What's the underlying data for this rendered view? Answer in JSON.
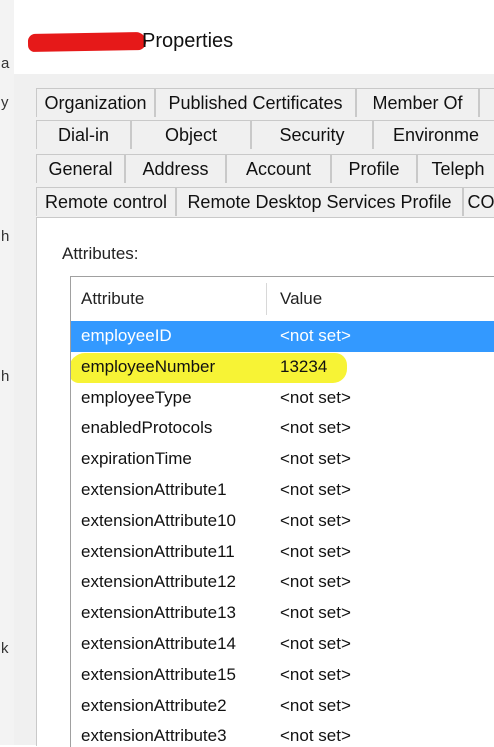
{
  "window": {
    "title": "Properties"
  },
  "left_strip": {
    "glyphs": [
      "a",
      "y",
      "h",
      "h",
      "k"
    ]
  },
  "tabs": {
    "row1": [
      "Organization",
      "Published Certificates",
      "Member Of",
      ""
    ],
    "row2": [
      "Dial-in",
      "Object",
      "Security",
      "Environme"
    ],
    "row3": [
      "General",
      "Address",
      "Account",
      "Profile",
      "Teleph"
    ],
    "row4": [
      "Remote control",
      "Remote Desktop Services Profile",
      "CO"
    ]
  },
  "attributes": {
    "caption": "Attributes:",
    "columns": {
      "attribute": "Attribute",
      "value": "Value"
    },
    "rows": [
      {
        "attribute": "employeeID",
        "value": "<not set>",
        "state": "selected"
      },
      {
        "attribute": "employeeNumber",
        "value": "13234",
        "state": "highlighted"
      },
      {
        "attribute": "employeeType",
        "value": "<not set>"
      },
      {
        "attribute": "enabledProtocols",
        "value": "<not set>"
      },
      {
        "attribute": "expirationTime",
        "value": "<not set>"
      },
      {
        "attribute": "extensionAttribute1",
        "value": "<not set>"
      },
      {
        "attribute": "extensionAttribute10",
        "value": "<not set>"
      },
      {
        "attribute": "extensionAttribute11",
        "value": "<not set>"
      },
      {
        "attribute": "extensionAttribute12",
        "value": "<not set>"
      },
      {
        "attribute": "extensionAttribute13",
        "value": "<not set>"
      },
      {
        "attribute": "extensionAttribute14",
        "value": "<not set>"
      },
      {
        "attribute": "extensionAttribute15",
        "value": "<not set>"
      },
      {
        "attribute": "extensionAttribute2",
        "value": "<not set>"
      },
      {
        "attribute": "extensionAttribute3",
        "value": "<not set>"
      }
    ]
  },
  "colors": {
    "selection": "#3399ff",
    "highlight": "#f7f22a",
    "redaction": "#e61919"
  }
}
